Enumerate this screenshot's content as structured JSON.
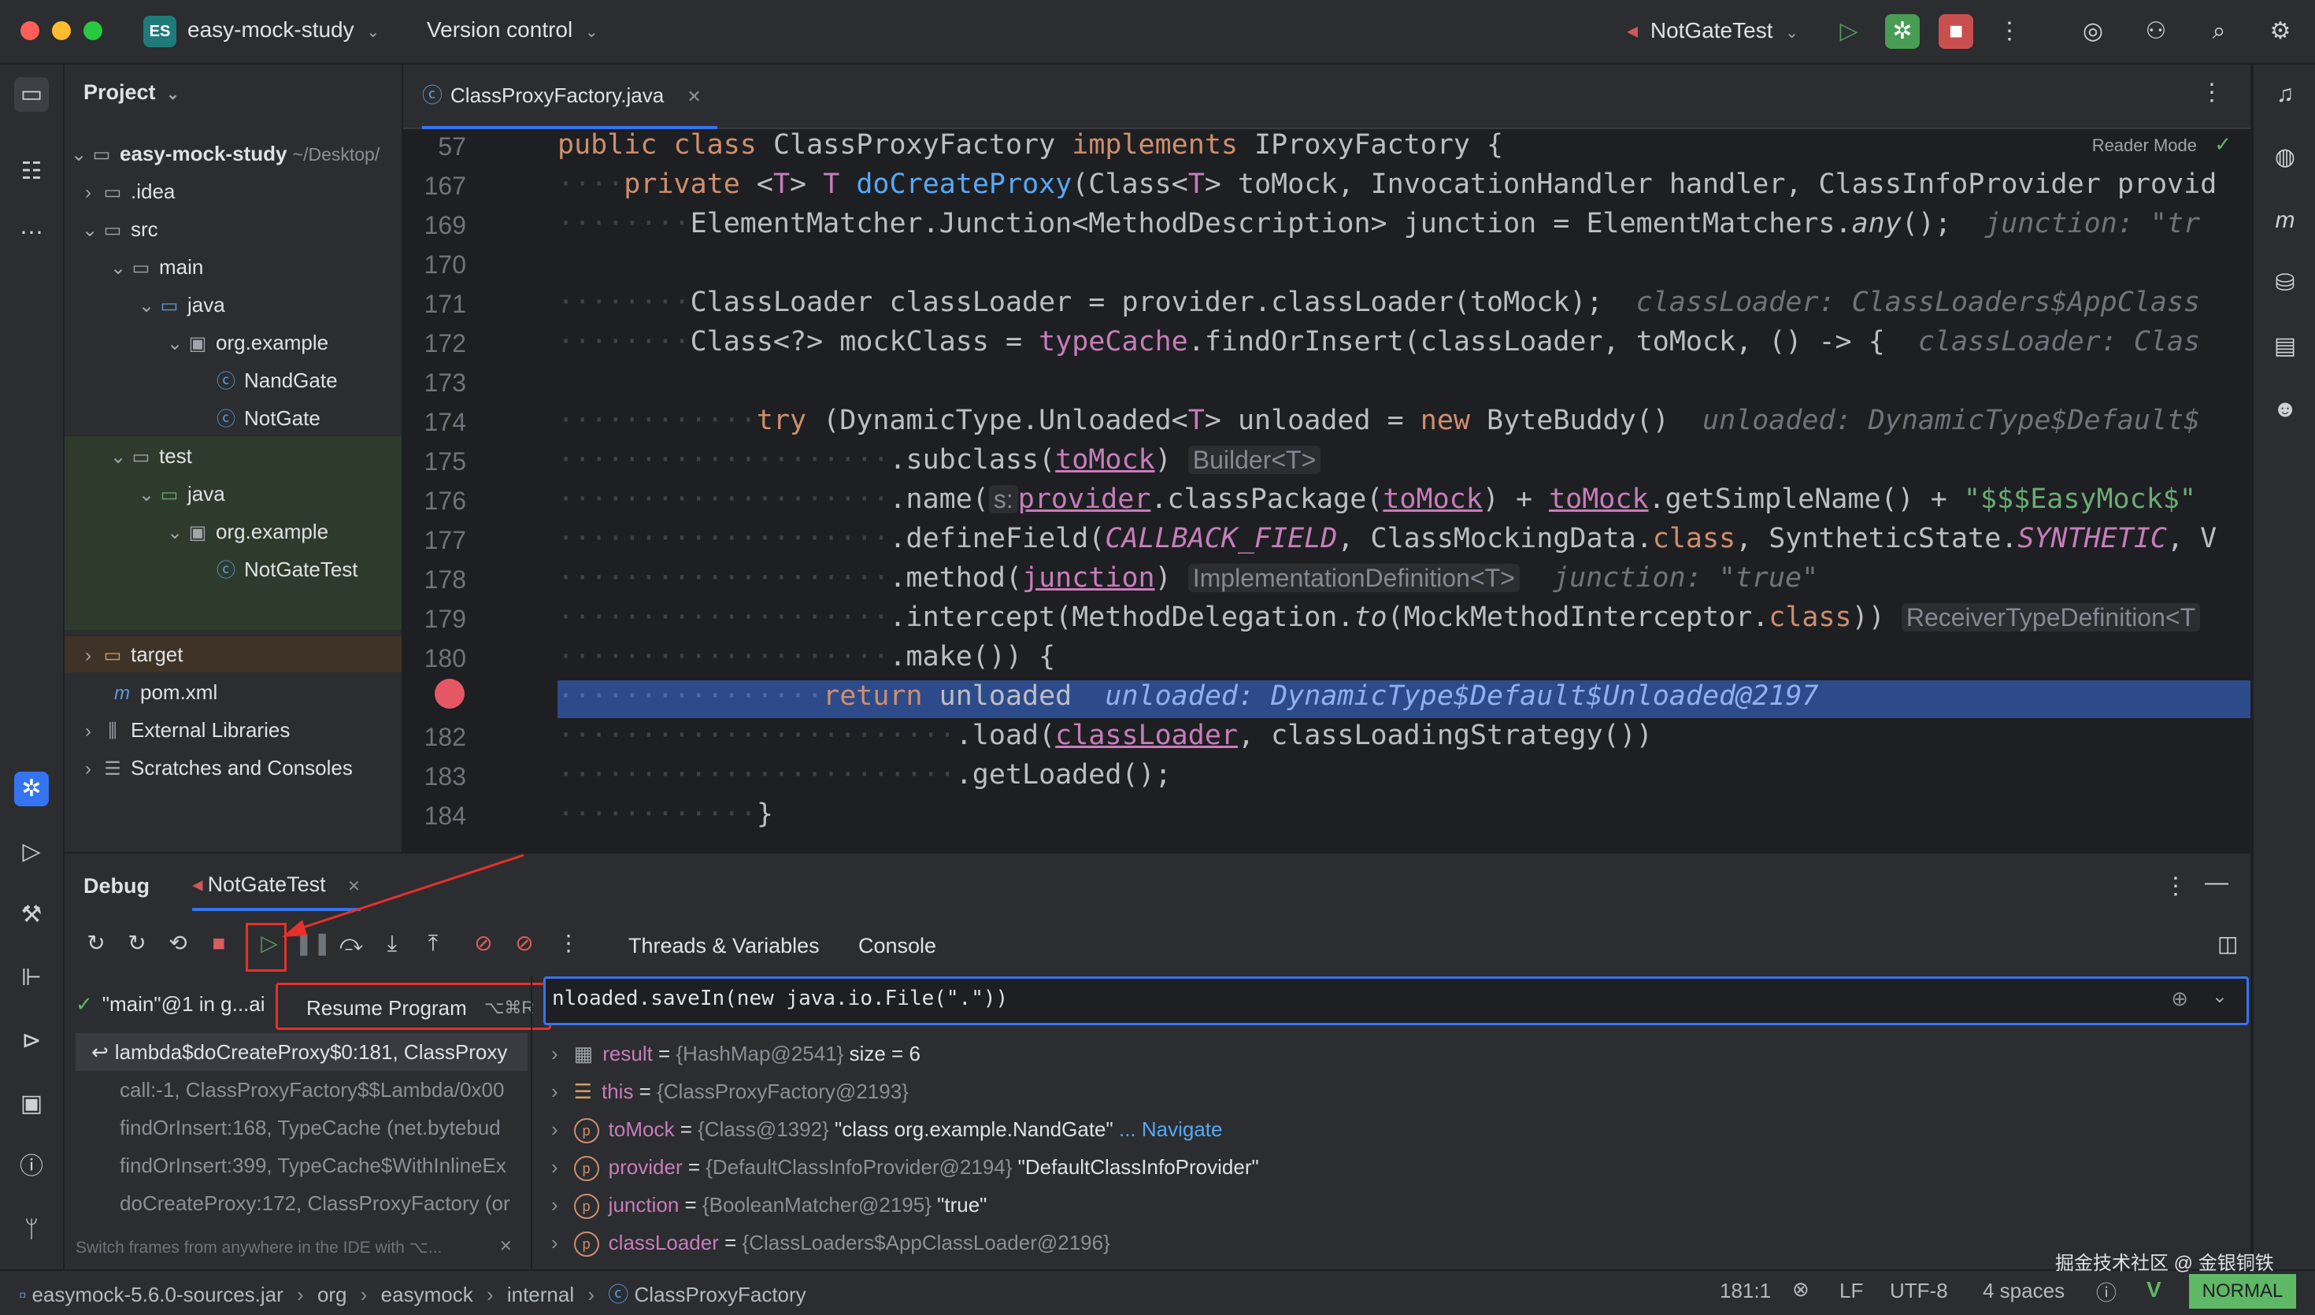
{
  "titlebar": {
    "project_badge": "ES",
    "project_name": "easy-mock-study",
    "vcs": "Version control",
    "run_config": "NotGateTest"
  },
  "project_panel": {
    "title": "Project",
    "tree": [
      {
        "label": "easy-mock-study",
        "suffix": "~/Desktop/"
      },
      {
        "label": ".idea"
      },
      {
        "label": "src"
      },
      {
        "label": "main"
      },
      {
        "label": "java"
      },
      {
        "label": "org.example"
      },
      {
        "label": "NandGate"
      },
      {
        "label": "NotGate"
      },
      {
        "label": "test"
      },
      {
        "label": "java"
      },
      {
        "label": "org.example"
      },
      {
        "label": "NotGateTest"
      },
      {
        "label": "target"
      },
      {
        "label": "pom.xml"
      },
      {
        "label": "External Libraries"
      },
      {
        "label": "Scratches and Consoles"
      }
    ]
  },
  "editor": {
    "tab_label": "ClassProxyFactory.java",
    "reader_mode": "Reader Mode",
    "line_numbers": [
      "57",
      "167",
      "169",
      "170",
      "171",
      "172",
      "173",
      "174",
      "175",
      "176",
      "177",
      "178",
      "179",
      "180",
      "",
      "182",
      "183",
      "184"
    ],
    "inline_hints": {
      "builder": "Builder<T>",
      "impl_def": "ImplementationDefinition<T>",
      "receiver_def": "ReceiverTypeDefinition<T",
      "param_s": "s:"
    },
    "debug_values": {
      "junction_hint": "junction: \"tr",
      "classloader_hint": "classLoader: ClassLoaders$AppClass",
      "classloader_hint2": "classLoader: Clas",
      "unloaded_hint": "unloaded: DynamicType$Default$",
      "junction_true": "junction: \"true\"",
      "unloaded_value": "unloaded: DynamicType$Default$Unloaded@2197"
    }
  },
  "debug": {
    "title": "Debug",
    "session_tab": "NotGateTest",
    "tab_threads": "Threads & Variables",
    "tab_console": "Console",
    "tooltip_label": "Resume Program",
    "tooltip_shortcut": "⌥⌘R",
    "thread_label": "\"main\"@1 in g...ai",
    "expression": "nloaded.saveIn(new java.io.File(\".\"))",
    "frames": [
      "lambda$doCreateProxy$0:181, ClassProxy",
      "call:-1, ClassProxyFactory$$Lambda/0x00",
      "findOrInsert:168, TypeCache (net.bytebud",
      "findOrInsert:399, TypeCache$WithInlineEx",
      "doCreateProxy:172, ClassProxyFactory (or"
    ],
    "frames_hint": "Switch frames from anywhere in the IDE with ⌥...",
    "variables": [
      {
        "name": "result",
        "ref": "{HashMap@2541}",
        "value": "size = 6"
      },
      {
        "name": "this",
        "ref": "{ClassProxyFactory@2193}",
        "value": ""
      },
      {
        "name": "toMock",
        "ref": "{Class@1392}",
        "value": "\"class org.example.NandGate\"",
        "link": "... Navigate"
      },
      {
        "name": "provider",
        "ref": "{DefaultClassInfoProvider@2194}",
        "value": "\"DefaultClassInfoProvider\""
      },
      {
        "name": "junction",
        "ref": "{BooleanMatcher@2195}",
        "value": "\"true\""
      },
      {
        "name": "classLoader",
        "ref": "{ClassLoaders$AppClassLoader@2196}",
        "value": ""
      }
    ]
  },
  "statusbar": {
    "breadcrumbs": [
      "easymock-5.6.0-sources.jar",
      "org",
      "easymock",
      "internal",
      "ClassProxyFactory"
    ],
    "position": "181:1",
    "line_sep": "LF",
    "encoding": "UTF-8",
    "indent": "4 spaces",
    "vim_mode": "NORMAL",
    "watermark": "掘金技术社区 @ 金银铜铁"
  },
  "colors": {
    "accent": "#3574f0",
    "highlight_line": "#2d4b8a",
    "annotation_red": "#e5312a",
    "run_green": "#499c54",
    "stop_red": "#db5c5c"
  }
}
